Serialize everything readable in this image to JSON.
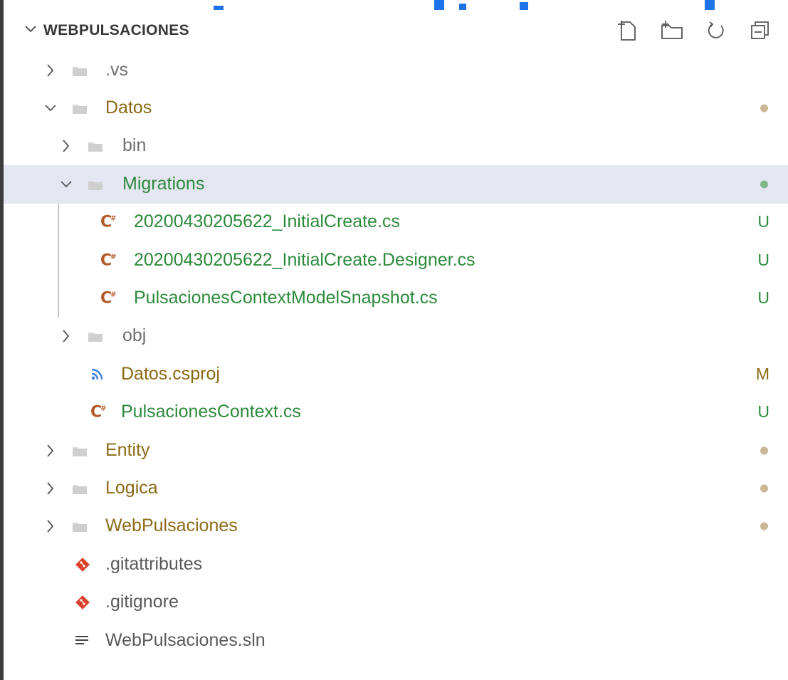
{
  "explorer": {
    "title": "WEBPULSACIONES",
    "actions": [
      {
        "name": "new-file-icon"
      },
      {
        "name": "new-folder-icon"
      },
      {
        "name": "refresh-icon"
      },
      {
        "name": "collapse-all-icon"
      }
    ]
  },
  "colors": {
    "untracked": "#2d8a3c",
    "modified": "#8b6a16",
    "default_text": "#5a5a5a",
    "dim_text": "#6f6f6f",
    "dot_modified": "#c9b796",
    "dot_untracked": "#7fb98a",
    "selection": "#e4e6f1"
  },
  "tree": [
    {
      "label": ".vs",
      "indent": 0,
      "kind": "folder",
      "expanded": false,
      "color": "dim",
      "status": "",
      "dot": ""
    },
    {
      "label": "Datos",
      "indent": 0,
      "kind": "folder",
      "expanded": true,
      "color": "modified",
      "status": "",
      "dot": "modified"
    },
    {
      "label": "bin",
      "indent": 1,
      "kind": "folder",
      "expanded": false,
      "color": "dim",
      "status": "",
      "dot": ""
    },
    {
      "label": "Migrations",
      "indent": 1,
      "kind": "folder",
      "expanded": true,
      "color": "untracked",
      "status": "",
      "dot": "untracked",
      "selected": true
    },
    {
      "label": "20200430205622_InitialCreate.cs",
      "indent": 2,
      "kind": "csharp",
      "color": "untracked",
      "status": "U",
      "dot": ""
    },
    {
      "label": "20200430205622_InitialCreate.Designer.cs",
      "indent": 2,
      "kind": "csharp",
      "color": "untracked",
      "status": "U",
      "dot": ""
    },
    {
      "label": "PulsacionesContextModelSnapshot.cs",
      "indent": 2,
      "kind": "csharp",
      "color": "untracked",
      "status": "U",
      "dot": ""
    },
    {
      "label": "obj",
      "indent": 1,
      "kind": "folder",
      "expanded": false,
      "color": "dim",
      "status": "",
      "dot": ""
    },
    {
      "label": "Datos.csproj",
      "indent": 1,
      "kind": "rss",
      "color": "modified",
      "status": "M",
      "dot": ""
    },
    {
      "label": "PulsacionesContext.cs",
      "indent": 1,
      "kind": "csharp",
      "color": "untracked",
      "status": "U",
      "dot": ""
    },
    {
      "label": "Entity",
      "indent": 0,
      "kind": "folder",
      "expanded": false,
      "color": "modified",
      "status": "",
      "dot": "modified"
    },
    {
      "label": "Logica",
      "indent": 0,
      "kind": "folder",
      "expanded": false,
      "color": "modified",
      "status": "",
      "dot": "modified"
    },
    {
      "label": "WebPulsaciones",
      "indent": 0,
      "kind": "folder",
      "expanded": false,
      "color": "modified",
      "status": "",
      "dot": "modified"
    },
    {
      "label": ".gitattributes",
      "indent": 0,
      "kind": "git",
      "color": "default",
      "status": "",
      "dot": ""
    },
    {
      "label": ".gitignore",
      "indent": 0,
      "kind": "git",
      "color": "default",
      "status": "",
      "dot": ""
    },
    {
      "label": "WebPulsaciones.sln",
      "indent": 0,
      "kind": "lines",
      "color": "default",
      "status": "",
      "dot": ""
    }
  ]
}
